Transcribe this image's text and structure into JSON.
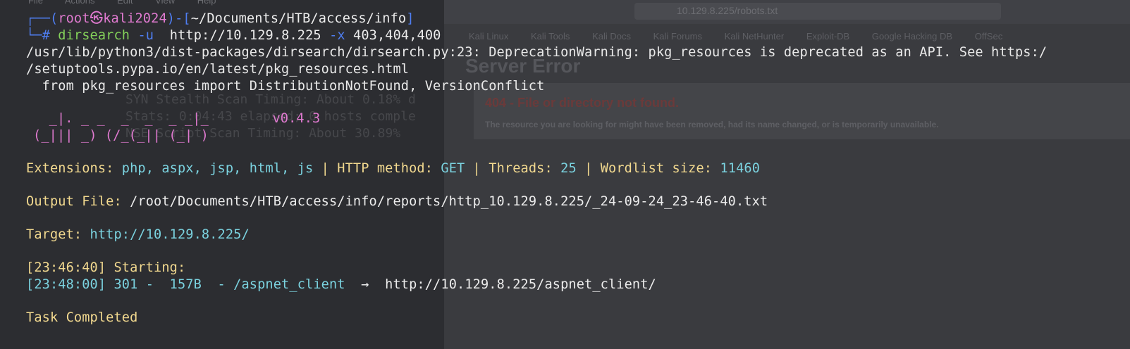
{
  "background": {
    "menu": [
      "File",
      "Actions",
      "Edit",
      "View",
      "Help"
    ],
    "url": "10.129.8.225/robots.txt",
    "bookmarks": [
      "Kali Linux",
      "Kali Tools",
      "Kali Docs",
      "Kali Forums",
      "Kali NetHunter",
      "Exploit-DB",
      "Google Hacking DB",
      "OffSec"
    ],
    "heading": "Server Error",
    "error_title": "404 - File or directory not found.",
    "error_message": "The resource you are looking for might have been removed, had its name changed, or is temporarily unavailable.",
    "nmap_lines": [
      "SYN Stealth Scan Timing: About 0.18% d",
      "Stats: 0:04:43 elapsed; 0 hosts comple",
      "NSE Script Scan Timing: About 30.89%"
    ]
  },
  "prompt": {
    "prefix": "┌──(",
    "user": "root㉿kali2024",
    "mid": ")-[",
    "path": "~/Documents/HTB/access/info",
    "end": "]",
    "prompt2": "└─",
    "hash": "#",
    "cmd": "dirsearch",
    "flag_u": "-u",
    "url": "http://10.129.8.225",
    "flag_x": "-x",
    "codes": "403,404,400"
  },
  "warning": {
    "line1": "/usr/lib/python3/dist-packages/dirsearch/dirsearch.py:23: DeprecationWarning: pkg_resources is deprecated as an API. See https:/",
    "line2": "/setuptools.pypa.io/en/latest/pkg_resources.html",
    "line3": "  from pkg_resources import DistributionNotFound, VersionConflict"
  },
  "banner": {
    "art1": "  _|. _ _  _  _  _ _|_",
    "version": "v0.4.3",
    "art2": "(_||| _) (/_(_|| (_| )"
  },
  "config": {
    "ext_label": "Extensions: ",
    "ext_value": "php, aspx, jsp, html, js",
    "sep": " | ",
    "method_label": "HTTP method: ",
    "method_value": "GET",
    "threads_label": "Threads: ",
    "threads_value": "25",
    "wordlist_label": "Wordlist size: ",
    "wordlist_value": "11460"
  },
  "output": {
    "label": "Output File: ",
    "value": "/root/Documents/HTB/access/info/reports/http_10.129.8.225/_24-09-24_23-46-40.txt"
  },
  "target": {
    "label": "Target: ",
    "value": "http://10.129.8.225/"
  },
  "log": {
    "start": "[23:46:40] Starting:",
    "result_prefix": "[23:48:00] 301 -  157B  - /aspnet_client  ",
    "arrow": "→",
    "result_target": "  http://10.129.8.225/aspnet_client/"
  },
  "done": "Task Completed"
}
